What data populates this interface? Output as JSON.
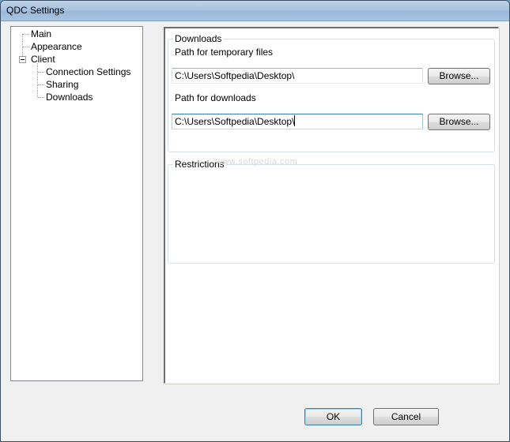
{
  "window": {
    "title": "QDC Settings"
  },
  "tree": {
    "items": [
      {
        "label": "Main"
      },
      {
        "label": "Appearance"
      },
      {
        "label": "Client"
      },
      {
        "label": "Connection Settings"
      },
      {
        "label": "Sharing"
      },
      {
        "label": "Downloads"
      }
    ]
  },
  "downloads_group": {
    "title": "Downloads",
    "temp_label": "Path for temporary files",
    "temp_value": "C:\\Users\\Softpedia\\Desktop\\",
    "downloads_label": "Path for downloads",
    "downloads_value": "C:\\Users\\Softpedia\\Desktop\\",
    "browse_label": "Browse..."
  },
  "restrictions_group": {
    "title": "Restrictions"
  },
  "watermark": "www.softpedia.com",
  "footer": {
    "ok_label": "OK",
    "cancel_label": "Cancel"
  }
}
